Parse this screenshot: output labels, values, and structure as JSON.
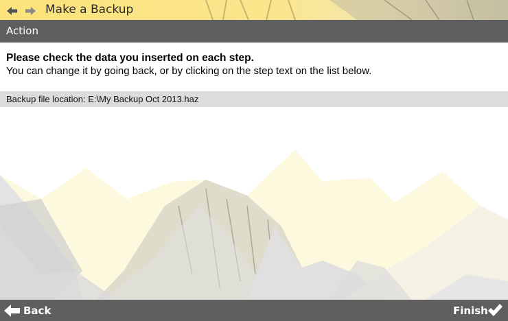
{
  "window": {
    "title": "Make a Backup",
    "back_nav_icon": "arrow-left-icon",
    "forward_nav_icon": "arrow-right-icon"
  },
  "section": {
    "header": "Action"
  },
  "content": {
    "instruction_title": "Please check the data you inserted on each step.",
    "instruction_text": "You can change it by going back, or by clicking on the step text on the list below.",
    "summary_items": [
      {
        "label": "Backup file location: E:\\My Backup Oct 2013.haz"
      }
    ]
  },
  "footer": {
    "back_label": "Back",
    "back_icon": "arrow-left-icon",
    "finish_label": "Finish",
    "finish_icon": "checkmark-icon"
  },
  "colors": {
    "bar_gray": "#5f5f5f",
    "row_gray": "#dcdcdc",
    "accent_yellow": "#fbe27a"
  }
}
